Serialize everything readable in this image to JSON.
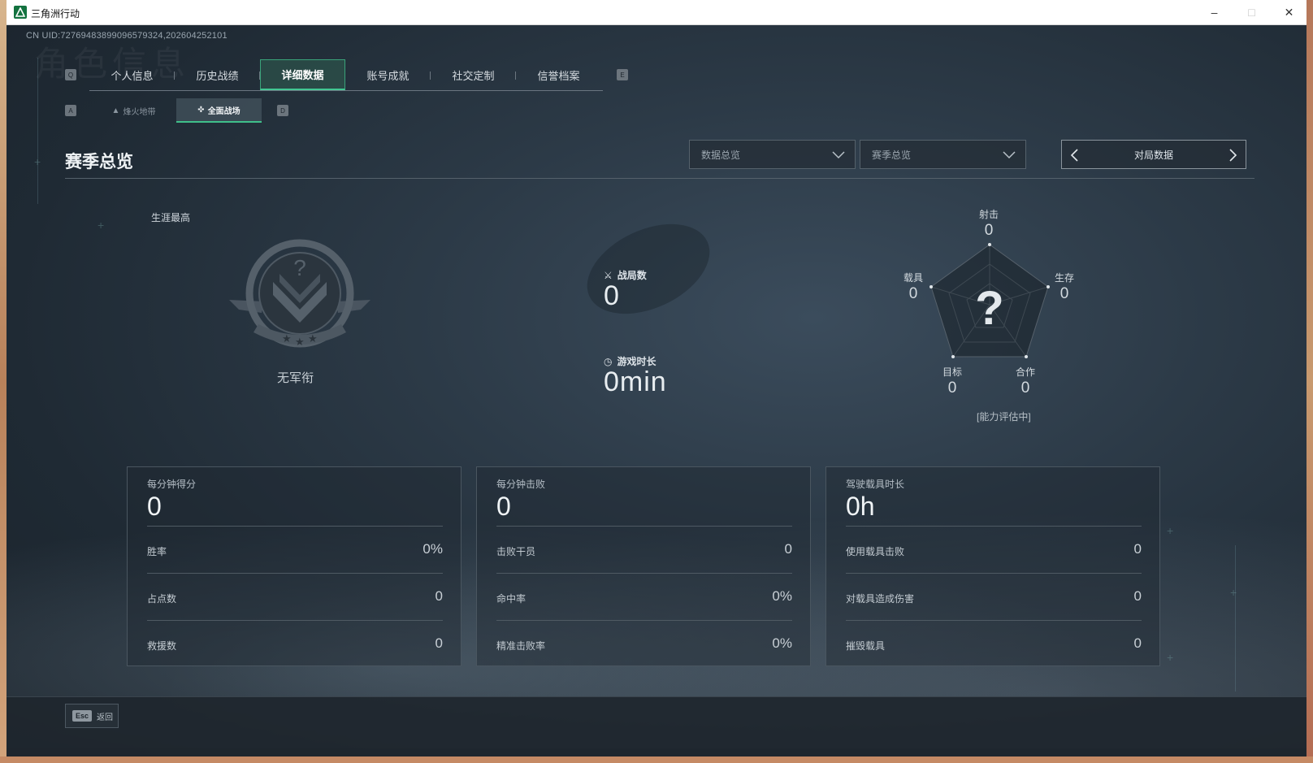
{
  "window": {
    "title": "三角洲行动"
  },
  "uid": "CN UID:7276948389909657932​4,202604252101",
  "watermark": "角色信息",
  "keys": {
    "prev_tab": "Q",
    "next_tab": "E",
    "prev_sub": "A",
    "next_sub": "D"
  },
  "tabs": [
    {
      "label": "个人信息"
    },
    {
      "label": "历史战绩"
    },
    {
      "label": "详细数据",
      "active": true
    },
    {
      "label": "账号成就"
    },
    {
      "label": "社交定制"
    },
    {
      "label": "信誉档案"
    }
  ],
  "subtabs": [
    {
      "label": "烽火地带",
      "icon": "flame-icon"
    },
    {
      "label": "全面战场",
      "icon": "battlefield-icon",
      "active": true
    }
  ],
  "section": {
    "title": "赛季总览"
  },
  "filters": {
    "data_select": "数据总览",
    "season_select": "赛季总览",
    "pager_label": "对局数据"
  },
  "career": {
    "label": "生涯最高",
    "rank_name": "无军衔"
  },
  "summary": {
    "matches_label": "战局数",
    "matches_value": "0",
    "playtime_label": "游戏时长",
    "playtime_value": "0min"
  },
  "radar": {
    "axes": [
      {
        "label": "射击",
        "value": "0"
      },
      {
        "label": "生存",
        "value": "0"
      },
      {
        "label": "合作",
        "value": "0"
      },
      {
        "label": "目标",
        "value": "0"
      },
      {
        "label": "载具",
        "value": "0"
      }
    ],
    "center_glyph": "?",
    "note": "[能力评估中]"
  },
  "cards": [
    {
      "label": "每分钟得分",
      "value": "0",
      "rows": [
        {
          "k": "胜率",
          "v": "0%"
        },
        {
          "k": "占点数",
          "v": "0"
        },
        {
          "k": "救援数",
          "v": "0"
        }
      ]
    },
    {
      "label": "每分钟击败",
      "value": "0",
      "rows": [
        {
          "k": "击败干员",
          "v": "0"
        },
        {
          "k": "命中率",
          "v": "0%"
        },
        {
          "k": "精准击败率",
          "v": "0%"
        }
      ]
    },
    {
      "label": "驾驶载具时长",
      "value": "0h",
      "rows": [
        {
          "k": "使用载具击败",
          "v": "0"
        },
        {
          "k": "对载具造成伤害",
          "v": "0"
        },
        {
          "k": "摧毁载具",
          "v": "0"
        }
      ]
    }
  ],
  "footer": {
    "esc_key": "Esc",
    "back_label": "返回"
  },
  "colors": {
    "accent": "#3fbf8a",
    "background": "#26323c"
  }
}
